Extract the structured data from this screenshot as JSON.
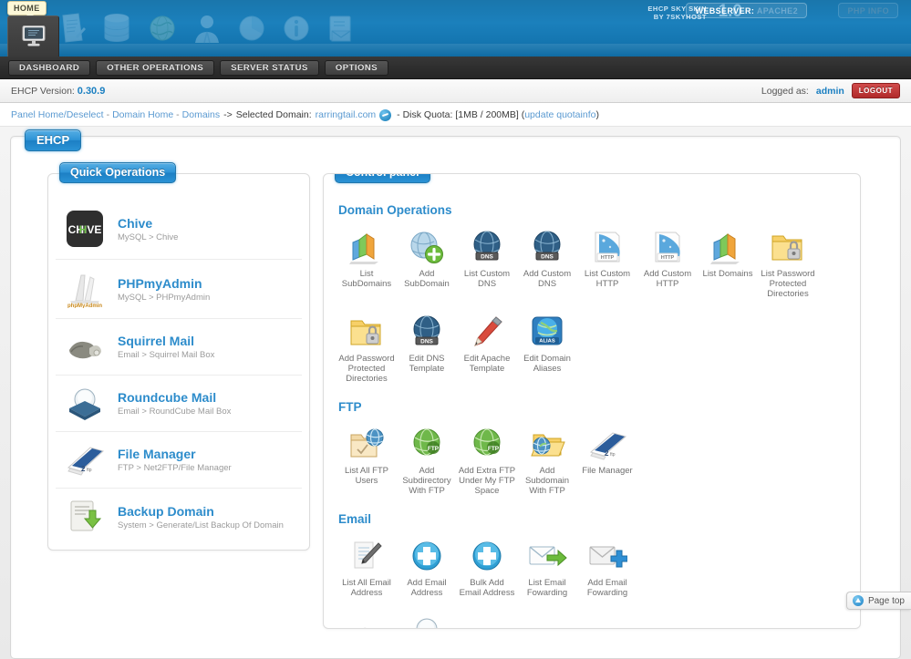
{
  "header": {
    "home_tooltip": "HOME",
    "home_icon": "monitor-icon",
    "icons": [
      "notepad-icon",
      "database-icon",
      "globe-icon",
      "user-icon",
      "pie-chart-icon",
      "info-icon",
      "mail-archive-icon"
    ],
    "skin_line1": "EHCP SKY SKIN",
    "skin_line2": "BY 7SKYHOST",
    "skin_version": "1.0",
    "webserver_label": "WEBSERVER:",
    "webserver_value": "APACHE2",
    "phpinfo_label": "PHP INFO"
  },
  "nav": {
    "items": [
      {
        "label": "DASHBOARD"
      },
      {
        "label": "OTHER OPERATIONS"
      },
      {
        "label": "SERVER STATUS"
      },
      {
        "label": "OPTIONS"
      }
    ]
  },
  "versionbar": {
    "label": "EHCP Version:",
    "value": "0.30.9",
    "logged_label": "Logged as:",
    "user": "admin",
    "logout_label": "LOGOUT"
  },
  "breadcrumb": {
    "panel_home": "Panel Home/Deselect",
    "domain_home": "Domain Home",
    "domains": "Domains",
    "arrow": "->",
    "selected_label": "Selected Domain:",
    "selected_domain": "rarringtail.com",
    "quota_label": "- Disk Quota: [1MB / 200MB] (",
    "quota_link": "update quotainfo",
    "quota_close": ")"
  },
  "ehcp_tab": "EHCP",
  "quick_operations": {
    "title": "Quick Operations",
    "items": [
      {
        "title": "Chive",
        "sub": "MySQL > Chive",
        "icon": "chive-icon"
      },
      {
        "title": "PHPmyAdmin",
        "sub": "MySQL > PHPmyAdmin",
        "icon": "phpmyadmin-icon"
      },
      {
        "title": "Squirrel Mail",
        "sub": "Email > Squirrel Mail Box",
        "icon": "squirrelmail-icon"
      },
      {
        "title": "Roundcube Mail",
        "sub": "Email > RoundCube Mail Box",
        "icon": "roundcube-icon"
      },
      {
        "title": "File Manager",
        "sub": "FTP > Net2FTP/File Manager",
        "icon": "net2ftp-icon"
      },
      {
        "title": "Backup Domain",
        "sub": "System > Generate/List Backup Of Domain",
        "icon": "backup-icon"
      }
    ]
  },
  "control_panel": {
    "title": "Control panel",
    "sections": [
      {
        "heading": "Domain Operations",
        "items": [
          {
            "label": "List\nSubDomains",
            "icon": "bar-chart-icon"
          },
          {
            "label": "Add\nSubDomain",
            "icon": "globe-plus-icon"
          },
          {
            "label": "List Custom\nDNS",
            "icon": "globe-dns-icon"
          },
          {
            "label": "Add Custom\nDNS",
            "icon": "globe-dns-icon"
          },
          {
            "label": "List Custom\nHTTP",
            "icon": "http-icon"
          },
          {
            "label": "Add Custom\nHTTP",
            "icon": "http-icon"
          },
          {
            "label": "List Domains",
            "icon": "bar-chart-icon"
          },
          {
            "label": "List Password\nProtected\nDirectories",
            "icon": "folder-lock-icon"
          },
          {
            "label": "Add Password\nProtected\nDirectories",
            "icon": "folder-lock-icon"
          },
          {
            "label": "Edit DNS\nTemplate",
            "icon": "globe-dns-icon"
          },
          {
            "label": "Edit Apache\nTemplate",
            "icon": "pencil-icon"
          },
          {
            "label": "Edit Domain\nAliases",
            "icon": "alias-icon"
          }
        ]
      },
      {
        "heading": "FTP",
        "items": [
          {
            "label": "List All FTP\nUsers",
            "icon": "folder-globe-icon"
          },
          {
            "label": "Add\nSubdirectory\nWith FTP",
            "icon": "green-ftp-icon"
          },
          {
            "label": "Add Extra FTP\nUnder My FTP\nSpace",
            "icon": "green-ftp-icon"
          },
          {
            "label": "Add\nSubdomain\nWith FTP",
            "icon": "folder-globe-open-icon"
          },
          {
            "label": "File Manager",
            "icon": "net2ftp-icon"
          }
        ]
      },
      {
        "heading": "Email",
        "items": [
          {
            "label": "List All Email\nAddress",
            "icon": "notepad-pen-icon"
          },
          {
            "label": "Add Email\nAddress",
            "icon": "blue-plus-icon"
          },
          {
            "label": "Bulk Add\nEmail Address",
            "icon": "blue-plus-icon"
          },
          {
            "label": "List Email\nFowarding",
            "icon": "envelope-arrow-icon"
          },
          {
            "label": "Add Email\nFowarding",
            "icon": "envelope-plus-icon"
          }
        ]
      },
      {
        "heading": "",
        "items": [
          {
            "label": "",
            "icon": "squirrelmail-icon"
          },
          {
            "label": "",
            "icon": "roundcube-icon"
          }
        ]
      }
    ]
  },
  "pagetop": {
    "label": "Page top",
    "icon": "arrow-up-circle-icon"
  },
  "colors": {
    "header_blue": "#1b80bc",
    "accent_blue": "#2d8ccb",
    "link_blue": "#5b9ad1",
    "nav_dark": "#2e2e2e",
    "logout_red": "#b02b2b"
  }
}
